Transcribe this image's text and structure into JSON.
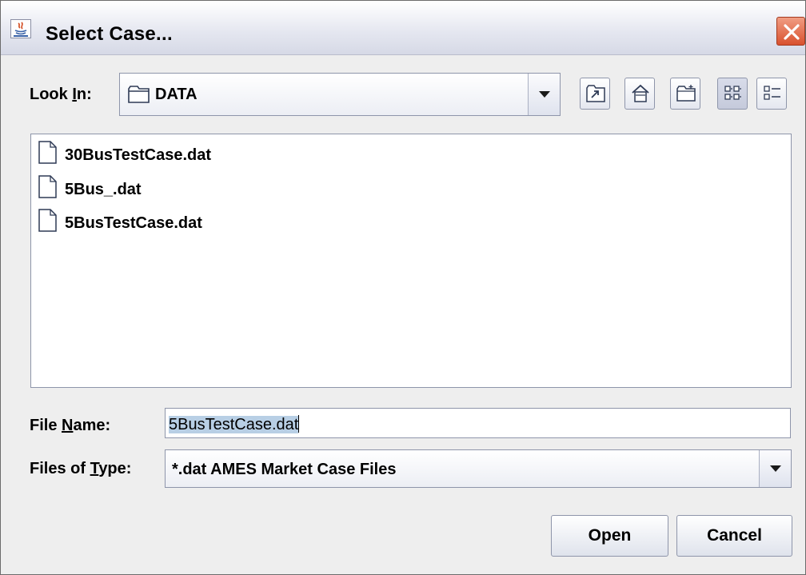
{
  "window": {
    "title": "Select Case..."
  },
  "look_in": {
    "label_pre": "Look ",
    "label_mnemonic": "I",
    "label_post": "n:",
    "value": "DATA",
    "toolbar": [
      "up-one-level",
      "home",
      "create-new-folder",
      "list-view",
      "details-view"
    ]
  },
  "files": [
    {
      "name": "30BusTestCase.dat"
    },
    {
      "name": "5Bus_.dat"
    },
    {
      "name": "5BusTestCase.dat"
    }
  ],
  "file_name": {
    "label_pre": "File ",
    "label_mnemonic": "N",
    "label_post": "ame:",
    "value": "5BusTestCase.dat"
  },
  "files_of_type": {
    "label_pre": "Files of ",
    "label_mnemonic": "T",
    "label_post": "ype:",
    "value": "*.dat AMES Market Case Files"
  },
  "buttons": {
    "open": "Open",
    "cancel": "Cancel"
  },
  "colors": {
    "selection": "#b8cfe5",
    "close_button": "#d9512e",
    "window_bg": "#eeeeee"
  }
}
